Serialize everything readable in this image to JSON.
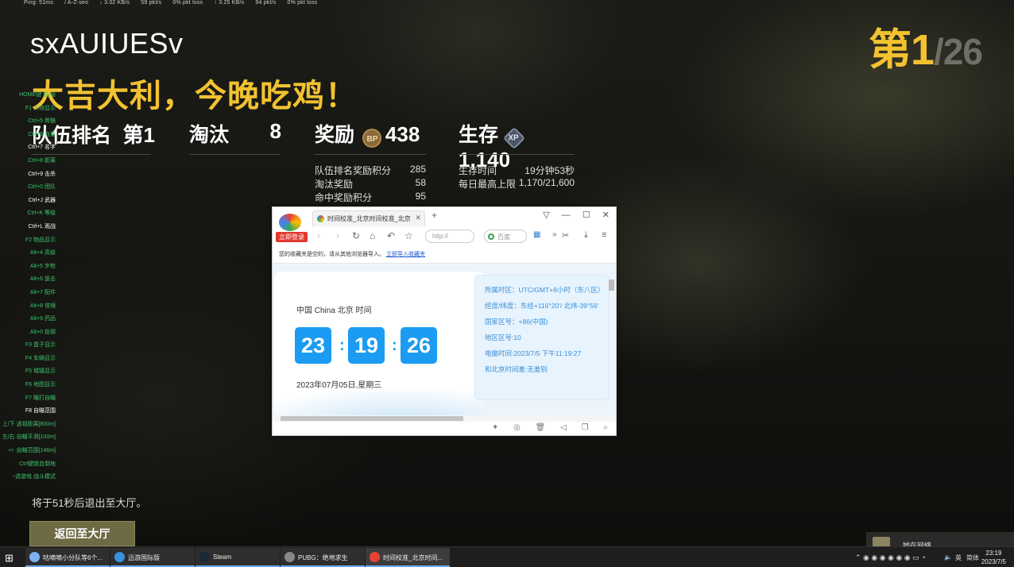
{
  "netstats": [
    "Ping: 51ms",
    "/ A-Z-seo",
    "↓ 3.02 KB/s",
    "59 pkt/s",
    "0% pkt loss",
    "↑ 3.25 KB/s",
    "94 pkt/s",
    "0% pkt loss"
  ],
  "player_name": "sxAUIUESv",
  "winner_text": "大吉大利，今晚吃鸡！",
  "rank": {
    "place": "第1",
    "total": "/26"
  },
  "stats": {
    "team_rank_label": "队伍排名",
    "team_rank_value": "第1",
    "kills_label": "淘汰",
    "kills_value": "8",
    "reward_label": "奖励",
    "bp_icon": "BP",
    "reward_value": "438",
    "survival_label": "生存",
    "xp_icon": "XP",
    "survival_value": "1,140"
  },
  "reward_rows": [
    {
      "label": "队伍排名奖励积分",
      "value": "285"
    },
    {
      "label": "淘汰奖励",
      "value": "58"
    },
    {
      "label": "命中奖励积分",
      "value": "95"
    }
  ],
  "survival_rows": [
    {
      "label": "生存时间",
      "value": "19分钟53秒"
    },
    {
      "label": "每日最高上限",
      "value": "1,170/21,600"
    }
  ],
  "hotkeys": [
    {
      "t": "HOME键 显/隐",
      "c": "g"
    },
    {
      "t": "F1 人物显示",
      "c": "g"
    },
    {
      "t": "Ctrl+5 骨骼",
      "c": "g"
    },
    {
      "t": "Ctrl+6 血量",
      "c": "g"
    },
    {
      "t": "Ctrl+7 名字",
      "c": "w"
    },
    {
      "t": "Ctrl+8 距离",
      "c": "g"
    },
    {
      "t": "Ctrl+9 击杀",
      "c": "w"
    },
    {
      "t": "Ctrl+0 团队",
      "c": "g"
    },
    {
      "t": "Ctrl+J 武器",
      "c": "w"
    },
    {
      "t": "Ctrl+K 等级",
      "c": "g"
    },
    {
      "t": "Ctrl+L 观战",
      "c": "w"
    },
    {
      "t": "F2 物品显示",
      "c": "g"
    },
    {
      "t": "Alt+4 高级",
      "c": "g"
    },
    {
      "t": "Alt+5 步枪",
      "c": "g"
    },
    {
      "t": "Alt+6 狙击",
      "c": "g"
    },
    {
      "t": "Alt+7 配件",
      "c": "g"
    },
    {
      "t": "Alt+8 倍镜",
      "c": "g"
    },
    {
      "t": "Alt+9 药品",
      "c": "g"
    },
    {
      "t": "Alt+0 投掷",
      "c": "g"
    },
    {
      "t": "F3 盒子显示",
      "c": "g"
    },
    {
      "t": "F4 车辆显示",
      "c": "g"
    },
    {
      "t": "F5 城镇显示",
      "c": "g"
    },
    {
      "t": "F6 地图显示",
      "c": "g"
    },
    {
      "t": "F7 瞄打自瞄",
      "c": "g"
    },
    {
      "t": "F8 自瞄范围",
      "c": "w"
    },
    {
      "t": "上/下 透视距离[800m]",
      "c": "g"
    },
    {
      "t": "左/右 自瞄平滑[100m]",
      "c": "g"
    },
    {
      "t": "+/- 自瞄范围[146m]",
      "c": "g"
    },
    {
      "t": "Ctrl键锁血倒地",
      "c": "g"
    },
    {
      "t": "~透游戏 战斗模式",
      "c": "g"
    }
  ],
  "exit_text": "将于51秒后退出至大厅。",
  "lobby_button": "返回至大厅",
  "browser": {
    "login_badge": "立即登录",
    "tab_title": "时间校准_北京时间校准_北京",
    "new_tab": "+",
    "win_controls": [
      "▽",
      "—",
      "☐",
      "✕"
    ],
    "address_placeholder": "http://",
    "search_placeholder": "百度",
    "favbar_text": "您的收藏夹是空的，请从其他浏览器导入。",
    "favbar_link": "立即导入收藏夹",
    "region_label": "中国 China 北京 时间",
    "hh": "23",
    "mm": "19",
    "ss": "26",
    "date": "2023年07月05日,星期三",
    "info": [
      "所属时区：UTC/GMT+8小时（东八区）",
      "经度/纬度：东经+116°20'/ 北纬-39°56'",
      "国家区号：+86(中国)",
      "地区区号:10",
      "电脑时间:2023/7/5 下午11:19:27",
      "和北京时间差:无差别"
    ]
  },
  "taskbar": {
    "items": [
      {
        "label": "咕嘀嘀小分队等6个...",
        "color": "#7bb4f0"
      },
      {
        "label": "迅游国际版",
        "color": "#3a8fe0"
      },
      {
        "label": "Steam",
        "color": "#1b2838"
      },
      {
        "label": "PUBG：绝地求生",
        "color": "#888888"
      },
      {
        "label": "时间校准_北京时间...",
        "color": "#e94235"
      }
    ],
    "notif": "她在网络",
    "tray_lang": "英",
    "tray_font": "简体",
    "time": "23:19",
    "date": "2023/7/5"
  }
}
